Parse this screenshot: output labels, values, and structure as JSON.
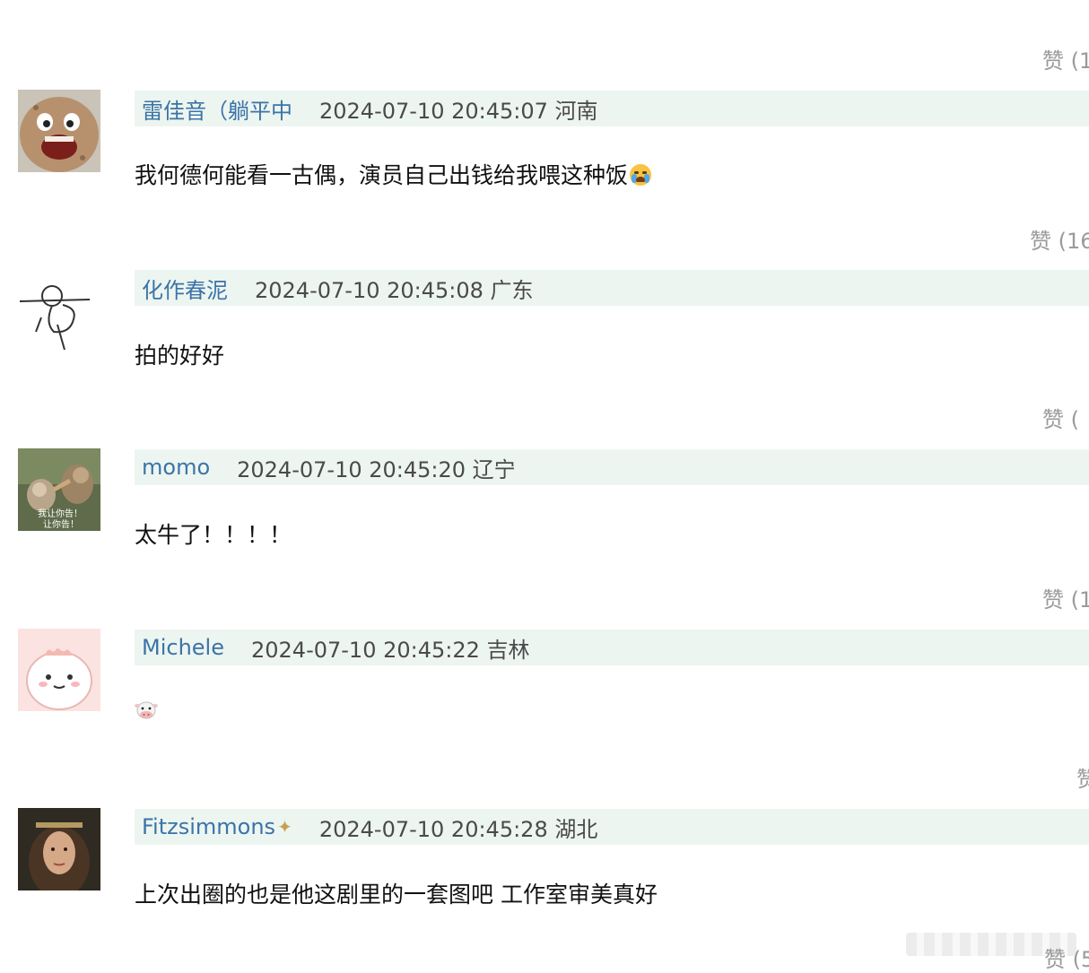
{
  "like_label": "赞",
  "comments": [
    {
      "like_text": "赞 (1",
      "username": "雷佳音（躺平中",
      "meta": "2024-07-10 20:45:07 河南",
      "content": "我何德何能看一古偶，演员自己出钱给我喂这种饭"
    },
    {
      "like_text": "赞 (16",
      "username": "化作春泥",
      "meta": "2024-07-10 20:45:08 广东",
      "content": "拍的好好"
    },
    {
      "like_text": "赞 (",
      "username": "momo",
      "meta": "2024-07-10 20:45:20 辽宁",
      "content": "太牛了！！！！",
      "avatar_text": [
        "我让你告！",
        "让你告！"
      ]
    },
    {
      "like_text": "赞 (1",
      "username": "Michele",
      "meta": "2024-07-10 20:45:22 吉林",
      "content": ""
    },
    {
      "like_text": "赞",
      "username": "Fitzsimmons",
      "meta": "2024-07-10 20:45:28 湖北",
      "content": "上次出圈的也是他这剧里的一套图吧 工作室审美真好"
    }
  ],
  "bottom_like_text": "赞 (5"
}
